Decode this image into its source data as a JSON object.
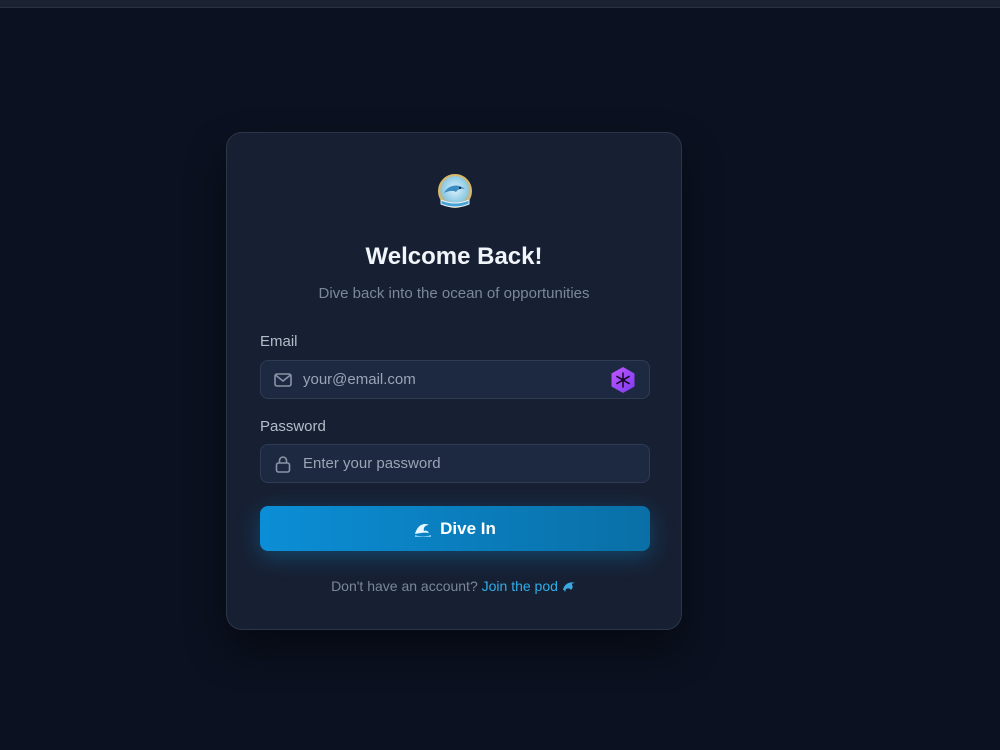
{
  "login": {
    "title": "Welcome Back!",
    "subtitle": "Dive back into the ocean of opportunities",
    "email": {
      "label": "Email",
      "placeholder": "your@email.com",
      "icon": "mail-icon"
    },
    "password": {
      "label": "Password",
      "placeholder": "Enter your password",
      "icon": "lock-icon"
    },
    "submit_label": "Dive In",
    "footer": {
      "prompt": "Don't have an account?",
      "link": "Join the pod"
    }
  },
  "colors": {
    "background": "#0b1120",
    "card": "#172033",
    "accent": "#0b8ed6",
    "link": "#2eaee8"
  }
}
